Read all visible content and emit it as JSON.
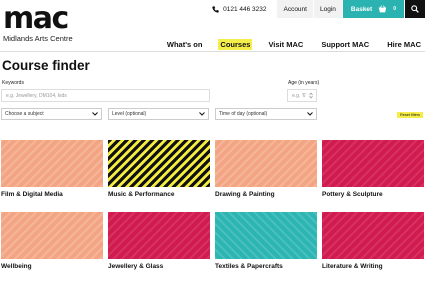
{
  "logo": {
    "word": "mac",
    "subtitle": "Midlands Arts Centre"
  },
  "topbar": {
    "phone": "0121 446 3232",
    "account": "Account",
    "login": "Login",
    "basket": "Basket",
    "basket_count": "0"
  },
  "nav": {
    "items": [
      {
        "label": "What's on",
        "active": false
      },
      {
        "label": "Courses",
        "active": true
      },
      {
        "label": "Visit MAC",
        "active": false
      },
      {
        "label": "Support MAC",
        "active": false
      },
      {
        "label": "Hire MAC",
        "active": false
      }
    ]
  },
  "page_title": "Course finder",
  "filters": {
    "keywords_label": "Keywords",
    "keywords_placeholder": "e.g. Jewellery, DM104, kids",
    "age_label": "Age (in years)",
    "age_placeholder": "e.g. '6'",
    "subject": "Choose a subject",
    "level": "Level (optional)",
    "time": "Time of day (optional)",
    "reset": "Reset filters"
  },
  "courses": [
    {
      "title": "Film & Digital Media",
      "pattern": "salmon"
    },
    {
      "title": "Music & Performance",
      "pattern": "yellow-black"
    },
    {
      "title": "Drawing & Painting",
      "pattern": "salmon"
    },
    {
      "title": "Pottery & Sculpture",
      "pattern": "crimson"
    },
    {
      "title": "Wellbeing",
      "pattern": "salmon"
    },
    {
      "title": "Jewellery & Glass",
      "pattern": "crimson"
    },
    {
      "title": "Textiles & Papercrafts",
      "pattern": "teal"
    },
    {
      "title": "Literature & Writing",
      "pattern": "crimson"
    }
  ],
  "colors": {
    "accent_yellow": "#f5ee4a",
    "basket_teal": "#2bb3b1",
    "salmon": "#f3a583",
    "crimson": "#d11a4e",
    "teal": "#2bb5b3",
    "yellow": "#f4ec3e"
  }
}
